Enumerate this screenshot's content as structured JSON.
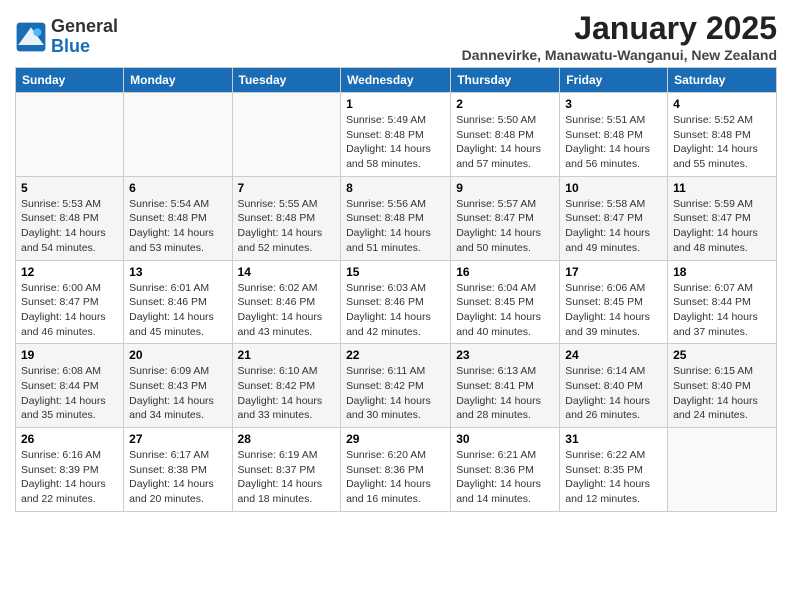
{
  "header": {
    "logo_general": "General",
    "logo_blue": "Blue",
    "month_title": "January 2025",
    "location": "Dannevirke, Manawatu-Wanganui, New Zealand"
  },
  "days_of_week": [
    "Sunday",
    "Monday",
    "Tuesday",
    "Wednesday",
    "Thursday",
    "Friday",
    "Saturday"
  ],
  "weeks": [
    [
      {
        "day": "",
        "info": ""
      },
      {
        "day": "",
        "info": ""
      },
      {
        "day": "",
        "info": ""
      },
      {
        "day": "1",
        "info": "Sunrise: 5:49 AM\nSunset: 8:48 PM\nDaylight: 14 hours\nand 58 minutes."
      },
      {
        "day": "2",
        "info": "Sunrise: 5:50 AM\nSunset: 8:48 PM\nDaylight: 14 hours\nand 57 minutes."
      },
      {
        "day": "3",
        "info": "Sunrise: 5:51 AM\nSunset: 8:48 PM\nDaylight: 14 hours\nand 56 minutes."
      },
      {
        "day": "4",
        "info": "Sunrise: 5:52 AM\nSunset: 8:48 PM\nDaylight: 14 hours\nand 55 minutes."
      }
    ],
    [
      {
        "day": "5",
        "info": "Sunrise: 5:53 AM\nSunset: 8:48 PM\nDaylight: 14 hours\nand 54 minutes."
      },
      {
        "day": "6",
        "info": "Sunrise: 5:54 AM\nSunset: 8:48 PM\nDaylight: 14 hours\nand 53 minutes."
      },
      {
        "day": "7",
        "info": "Sunrise: 5:55 AM\nSunset: 8:48 PM\nDaylight: 14 hours\nand 52 minutes."
      },
      {
        "day": "8",
        "info": "Sunrise: 5:56 AM\nSunset: 8:48 PM\nDaylight: 14 hours\nand 51 minutes."
      },
      {
        "day": "9",
        "info": "Sunrise: 5:57 AM\nSunset: 8:47 PM\nDaylight: 14 hours\nand 50 minutes."
      },
      {
        "day": "10",
        "info": "Sunrise: 5:58 AM\nSunset: 8:47 PM\nDaylight: 14 hours\nand 49 minutes."
      },
      {
        "day": "11",
        "info": "Sunrise: 5:59 AM\nSunset: 8:47 PM\nDaylight: 14 hours\nand 48 minutes."
      }
    ],
    [
      {
        "day": "12",
        "info": "Sunrise: 6:00 AM\nSunset: 8:47 PM\nDaylight: 14 hours\nand 46 minutes."
      },
      {
        "day": "13",
        "info": "Sunrise: 6:01 AM\nSunset: 8:46 PM\nDaylight: 14 hours\nand 45 minutes."
      },
      {
        "day": "14",
        "info": "Sunrise: 6:02 AM\nSunset: 8:46 PM\nDaylight: 14 hours\nand 43 minutes."
      },
      {
        "day": "15",
        "info": "Sunrise: 6:03 AM\nSunset: 8:46 PM\nDaylight: 14 hours\nand 42 minutes."
      },
      {
        "day": "16",
        "info": "Sunrise: 6:04 AM\nSunset: 8:45 PM\nDaylight: 14 hours\nand 40 minutes."
      },
      {
        "day": "17",
        "info": "Sunrise: 6:06 AM\nSunset: 8:45 PM\nDaylight: 14 hours\nand 39 minutes."
      },
      {
        "day": "18",
        "info": "Sunrise: 6:07 AM\nSunset: 8:44 PM\nDaylight: 14 hours\nand 37 minutes."
      }
    ],
    [
      {
        "day": "19",
        "info": "Sunrise: 6:08 AM\nSunset: 8:44 PM\nDaylight: 14 hours\nand 35 minutes."
      },
      {
        "day": "20",
        "info": "Sunrise: 6:09 AM\nSunset: 8:43 PM\nDaylight: 14 hours\nand 34 minutes."
      },
      {
        "day": "21",
        "info": "Sunrise: 6:10 AM\nSunset: 8:42 PM\nDaylight: 14 hours\nand 33 minutes."
      },
      {
        "day": "22",
        "info": "Sunrise: 6:11 AM\nSunset: 8:42 PM\nDaylight: 14 hours\nand 30 minutes."
      },
      {
        "day": "23",
        "info": "Sunrise: 6:13 AM\nSunset: 8:41 PM\nDaylight: 14 hours\nand 28 minutes."
      },
      {
        "day": "24",
        "info": "Sunrise: 6:14 AM\nSunset: 8:40 PM\nDaylight: 14 hours\nand 26 minutes."
      },
      {
        "day": "25",
        "info": "Sunrise: 6:15 AM\nSunset: 8:40 PM\nDaylight: 14 hours\nand 24 minutes."
      }
    ],
    [
      {
        "day": "26",
        "info": "Sunrise: 6:16 AM\nSunset: 8:39 PM\nDaylight: 14 hours\nand 22 minutes."
      },
      {
        "day": "27",
        "info": "Sunrise: 6:17 AM\nSunset: 8:38 PM\nDaylight: 14 hours\nand 20 minutes."
      },
      {
        "day": "28",
        "info": "Sunrise: 6:19 AM\nSunset: 8:37 PM\nDaylight: 14 hours\nand 18 minutes."
      },
      {
        "day": "29",
        "info": "Sunrise: 6:20 AM\nSunset: 8:36 PM\nDaylight: 14 hours\nand 16 minutes."
      },
      {
        "day": "30",
        "info": "Sunrise: 6:21 AM\nSunset: 8:36 PM\nDaylight: 14 hours\nand 14 minutes."
      },
      {
        "day": "31",
        "info": "Sunrise: 6:22 AM\nSunset: 8:35 PM\nDaylight: 14 hours\nand 12 minutes."
      },
      {
        "day": "",
        "info": ""
      }
    ]
  ]
}
